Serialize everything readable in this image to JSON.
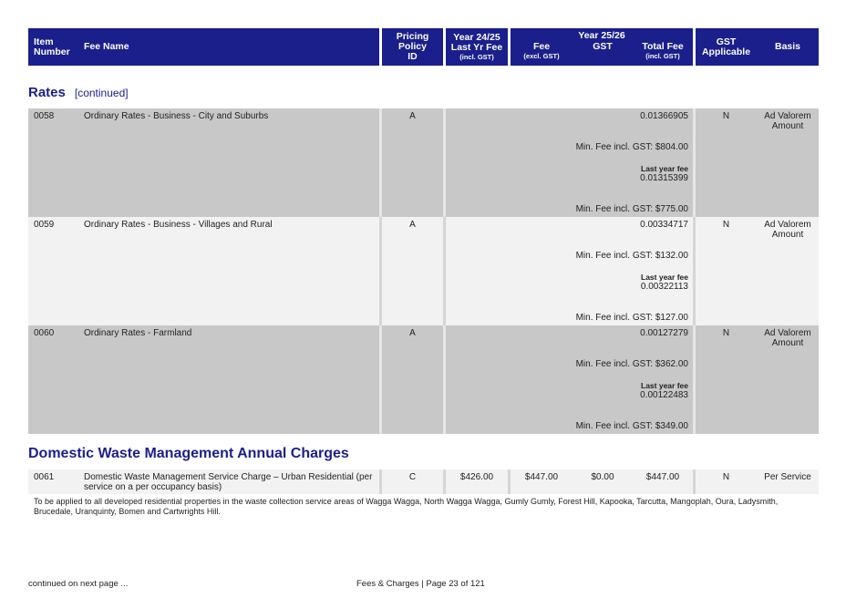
{
  "header": {
    "item_number": "Item Number",
    "fee_name": "Fee Name",
    "pricing_policy": "Pricing Policy ID",
    "year_24_25": "Year 24/25",
    "last_yr_fee": "Last Yr Fee",
    "incl_gst": "(incl. GST)",
    "year_25_26": "Year 25/26",
    "fee": "Fee",
    "excl_gst": "(excl. GST)",
    "gst": "GST",
    "total_fee": "Total Fee",
    "total_incl_gst": "(incl. GST)",
    "gst_applicable": "GST Applicable",
    "basis": "Basis"
  },
  "rates_section": {
    "title": "Rates",
    "continued": "[continued]"
  },
  "rates_rows": [
    {
      "item": "0058",
      "name": "Ordinary Rates - Business - City and Suburbs",
      "policy": "A",
      "total": "0.01366905",
      "min_fee": "Min. Fee incl. GST: $804.00",
      "last_year_label": "Last year fee",
      "last_year_value": "0.01315399",
      "last_min_fee": "Min. Fee incl. GST: $775.00",
      "gst_applicable": "N",
      "basis": "Ad Valorem Amount"
    },
    {
      "item": "0059",
      "name": "Ordinary Rates - Business - Villages and Rural",
      "policy": "A",
      "total": "0.00334717",
      "min_fee": "Min. Fee incl. GST: $132.00",
      "last_year_label": "Last year fee",
      "last_year_value": "0.00322113",
      "last_min_fee": "Min. Fee incl. GST: $127.00",
      "gst_applicable": "N",
      "basis": "Ad Valorem Amount"
    },
    {
      "item": "0060",
      "name": "Ordinary Rates - Farmland",
      "policy": "A",
      "total": "0.00127279",
      "min_fee": "Min. Fee incl. GST: $362.00",
      "last_year_label": "Last year fee",
      "last_year_value": "0.00122483",
      "last_min_fee": "Min. Fee incl. GST: $349.00",
      "gst_applicable": "N",
      "basis": "Ad Valorem Amount"
    }
  ],
  "waste_section": {
    "title": "Domestic Waste Management Annual Charges"
  },
  "waste_row": {
    "item": "0061",
    "name": "Domestic Waste Management Service Charge – Urban Residential (per service on a per occupancy basis)",
    "policy": "C",
    "last_yr_fee": "$426.00",
    "fee": "$447.00",
    "gst": "$0.00",
    "total": "$447.00",
    "gst_applicable": "N",
    "basis": "Per Service",
    "note": "To be applied to all developed residential properties in the waste collection service areas of Wagga Wagga, North Wagga Wagga, Gumly Gumly, Forest Hill, Kapooka, Tarcutta, Mangoplah, Oura, Ladysmith, Brucedale, Uranquinty, Bomen and Cartwrights Hill."
  },
  "footer": {
    "continued": "continued on next page ...",
    "page": "Fees & Charges | Page 23 of 121"
  }
}
